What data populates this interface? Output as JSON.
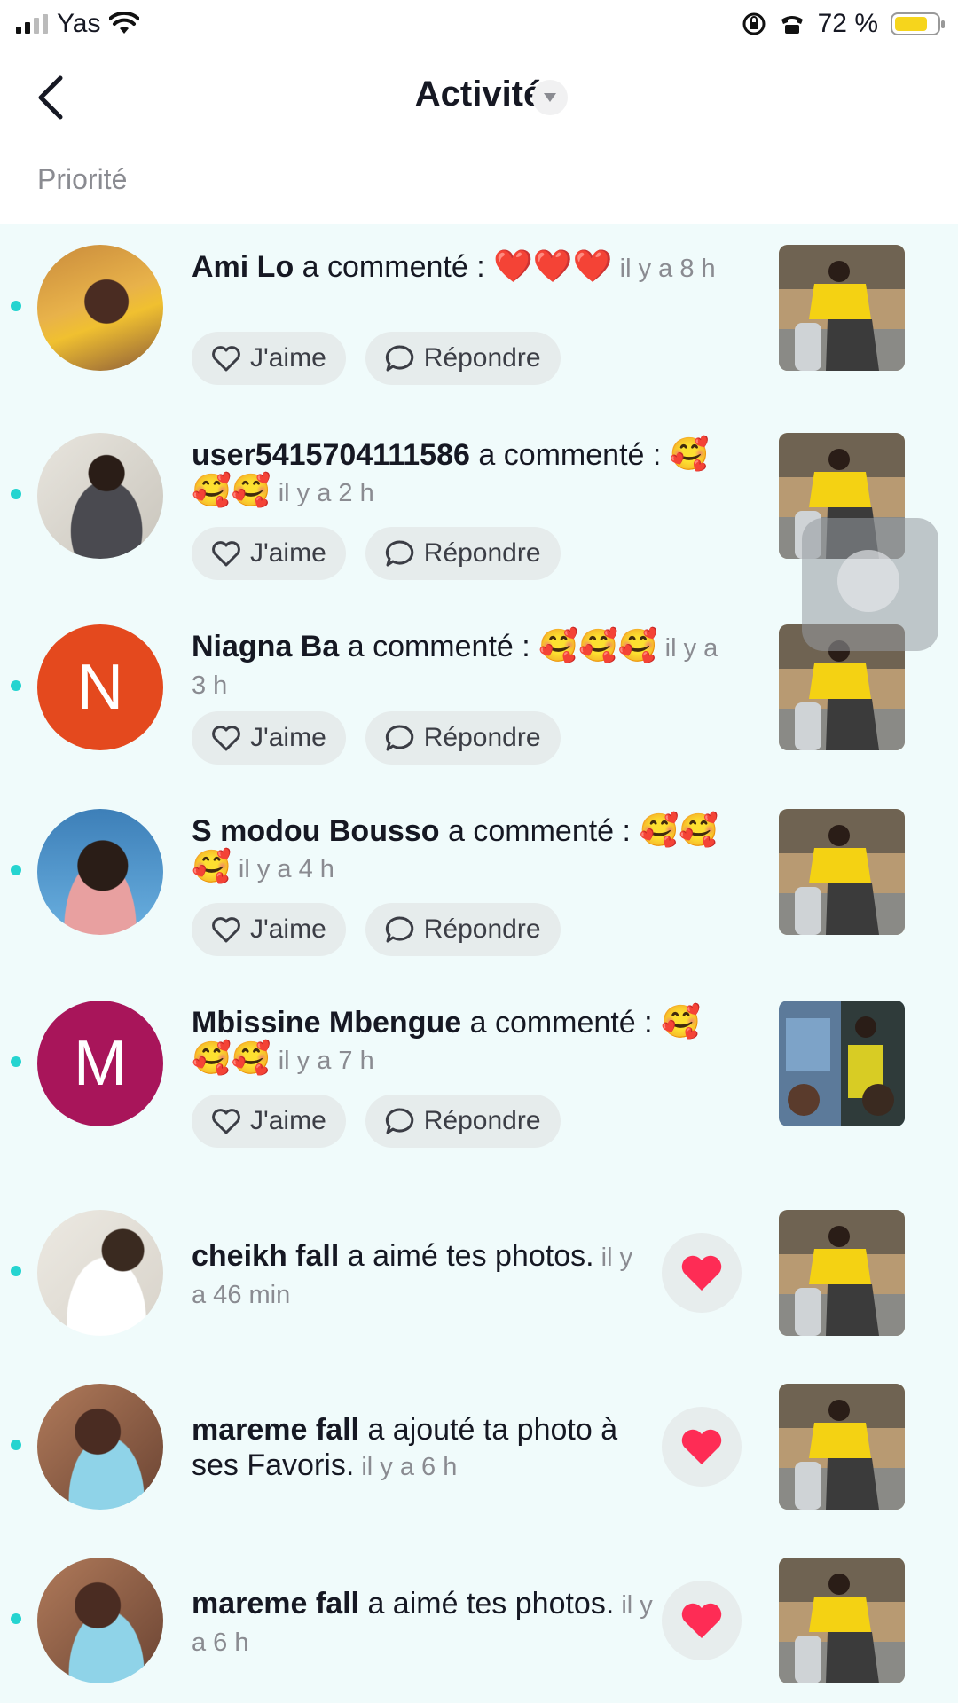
{
  "status_bar": {
    "carrier": "Yas",
    "battery": "72 %"
  },
  "header": {
    "title": "Activité"
  },
  "section_label": "Priorité",
  "actions": {
    "like": "J'aime",
    "reply": "Répondre"
  },
  "comments": [
    {
      "name": "Ami Lo",
      "verb": " a commenté : ",
      "emoji": "❤️❤️❤️",
      "time": " il y a 8 h",
      "avatar_letter": "",
      "avatar_color": "#c98b3c"
    },
    {
      "name": "user5415704111586",
      "verb": " a commenté : ",
      "emoji": "🥰🥰🥰",
      "time": " il y a 2 h",
      "avatar_letter": "",
      "avatar_color": "#9aa0a6"
    },
    {
      "name": "Niagna Ba",
      "verb": " a commenté : ",
      "emoji": "🥰🥰🥰",
      "time": " il y a 3 h",
      "avatar_letter": "N",
      "avatar_color": "#e4491e"
    },
    {
      "name": "S modou Bousso",
      "verb": " a commenté : ",
      "emoji": "🥰🥰🥰",
      "time": " il y a 4 h",
      "avatar_letter": "",
      "avatar_color": "#3d7fb8"
    },
    {
      "name": "Mbissine Mbengue",
      "verb": " a commenté : ",
      "emoji": "🥰🥰🥰",
      "time": " il y a 7 h",
      "avatar_letter": "M",
      "avatar_color": "#a8155a"
    }
  ],
  "likes": [
    {
      "name": "cheikh fall",
      "text": " a aimé tes photos.",
      "time": " il y a 46 min"
    },
    {
      "name": "mareme fall",
      "text": " a ajouté ta photo à ses Favoris.",
      "time": " il y a 6 h"
    },
    {
      "name": "mareme fall",
      "text": " a aimé tes photos.",
      "time": " il y a 6 h"
    }
  ],
  "colors": {
    "unread_dot": "#25d4d0",
    "list_bg": "#f0fbfb",
    "heart": "#fe2c55"
  }
}
